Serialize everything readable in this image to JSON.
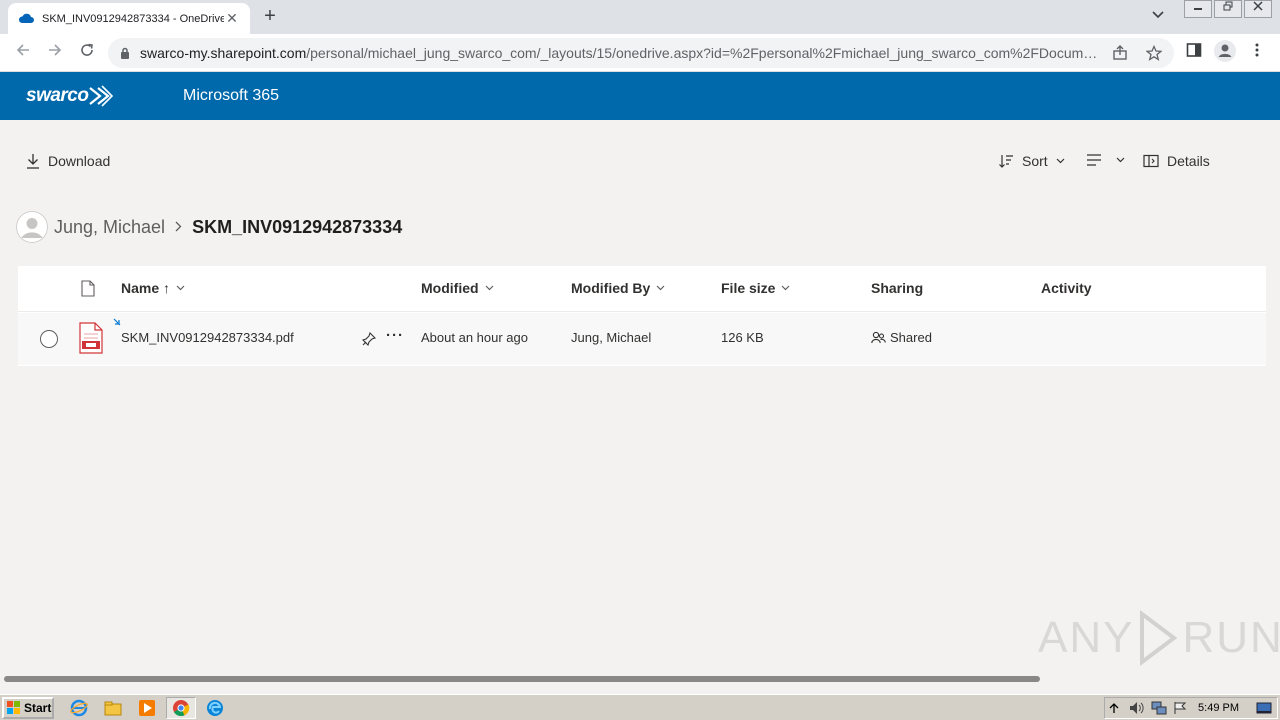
{
  "browser": {
    "tab_title": "SKM_INV0912942873334 - OneDrive",
    "tab_close": "✕",
    "new_tab": "+",
    "url_host": "swarco-my.sharepoint.com",
    "url_path": "/personal/michael_jung_swarco_com/_layouts/15/onedrive.aspx?id=%2Fpersonal%2Fmichael_jung_swarco_com%2FDocume..."
  },
  "suite": {
    "brand": "swarco",
    "title": "Microsoft 365"
  },
  "commands": {
    "download": "Download",
    "sort": "Sort",
    "details": "Details"
  },
  "breadcrumb": {
    "user": "Jung, Michael",
    "current": "SKM_INV0912942873334"
  },
  "columns": {
    "name": "Name ↑",
    "modified": "Modified",
    "modified_by": "Modified By",
    "file_size": "File size",
    "sharing": "Sharing",
    "activity": "Activity"
  },
  "files": [
    {
      "name": "SKM_INV0912942873334.pdf",
      "modified": "About an hour ago",
      "modified_by": "Jung, Michael",
      "file_size": "126 KB",
      "sharing": "Shared",
      "more": "···"
    }
  ],
  "watermark": "ANY RUN",
  "taskbar": {
    "start": "Start",
    "clock": "5:49 PM"
  },
  "colors": {
    "suitebar": "#0069ac",
    "pdf_red": "#d13438",
    "accent": "#0078d4"
  }
}
